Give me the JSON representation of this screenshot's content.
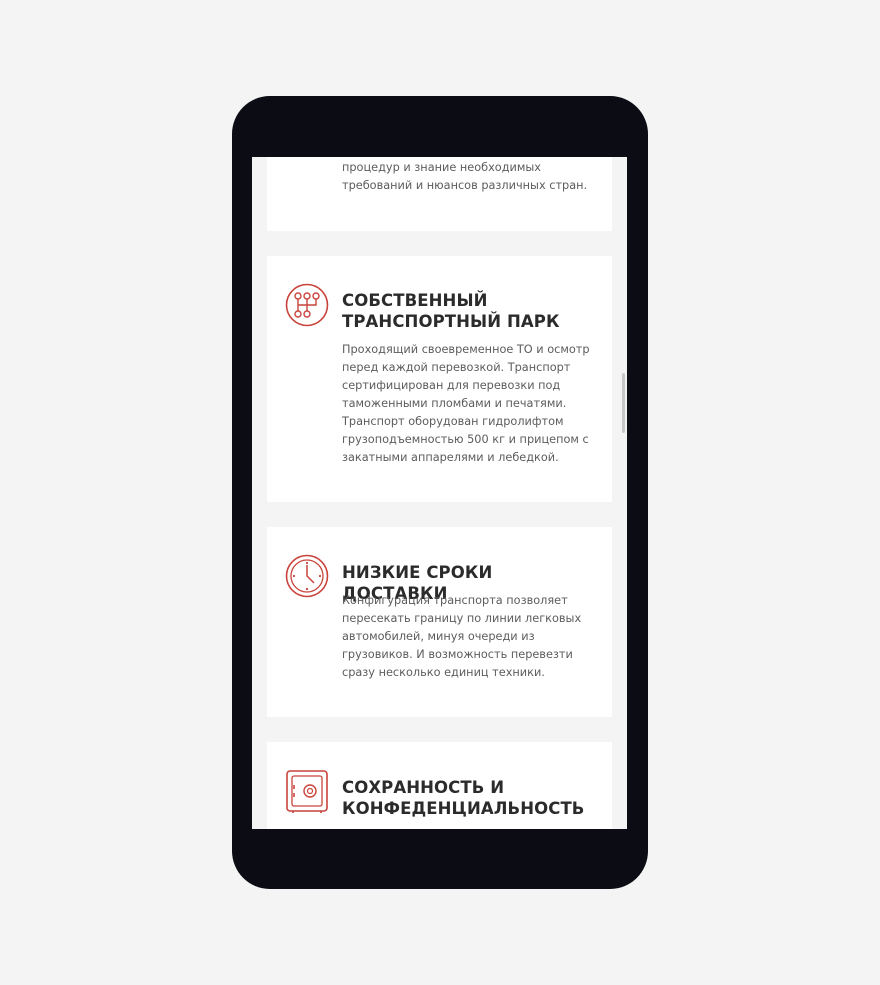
{
  "colors": {
    "accent": "#c9443b",
    "device_frame": "#0b0c14",
    "page_background": "#f4f4f4",
    "card_background": "#ffffff",
    "title_text": "#2b2b2b",
    "body_text": "#5c5c5c"
  },
  "cards": [
    {
      "icon": "",
      "title": "",
      "text": "процедур и знание необходимых требований и нюансов различных стран."
    },
    {
      "icon": "gearshift-icon",
      "title": "СОБСТВЕННЫЙ ТРАНСПОРТНЫЙ ПАРК",
      "text": "Проходящий своевременное ТО и осмотр перед каждой перевозкой. Транспорт сертифицирован для перевозки под таможенными пломбами и печатями. Транспорт оборудован гидролифтом грузоподъемностью 500 кг и прицепом с закатными аппарелями и лебедкой."
    },
    {
      "icon": "clock-icon",
      "title": "НИЗКИЕ СРОКИ ДОСТАВКИ",
      "text": "Конфигурация транспорта позволяет пересекать границу по линии легковых автомобилей, минуя очереди из грузовиков. И возможность перевезти сразу несколько единиц техники."
    },
    {
      "icon": "safe-icon",
      "title": "СОХРАННОСТЬ И КОНФЕДЕНЦИАЛЬНОСТЬ",
      "text": ""
    }
  ]
}
